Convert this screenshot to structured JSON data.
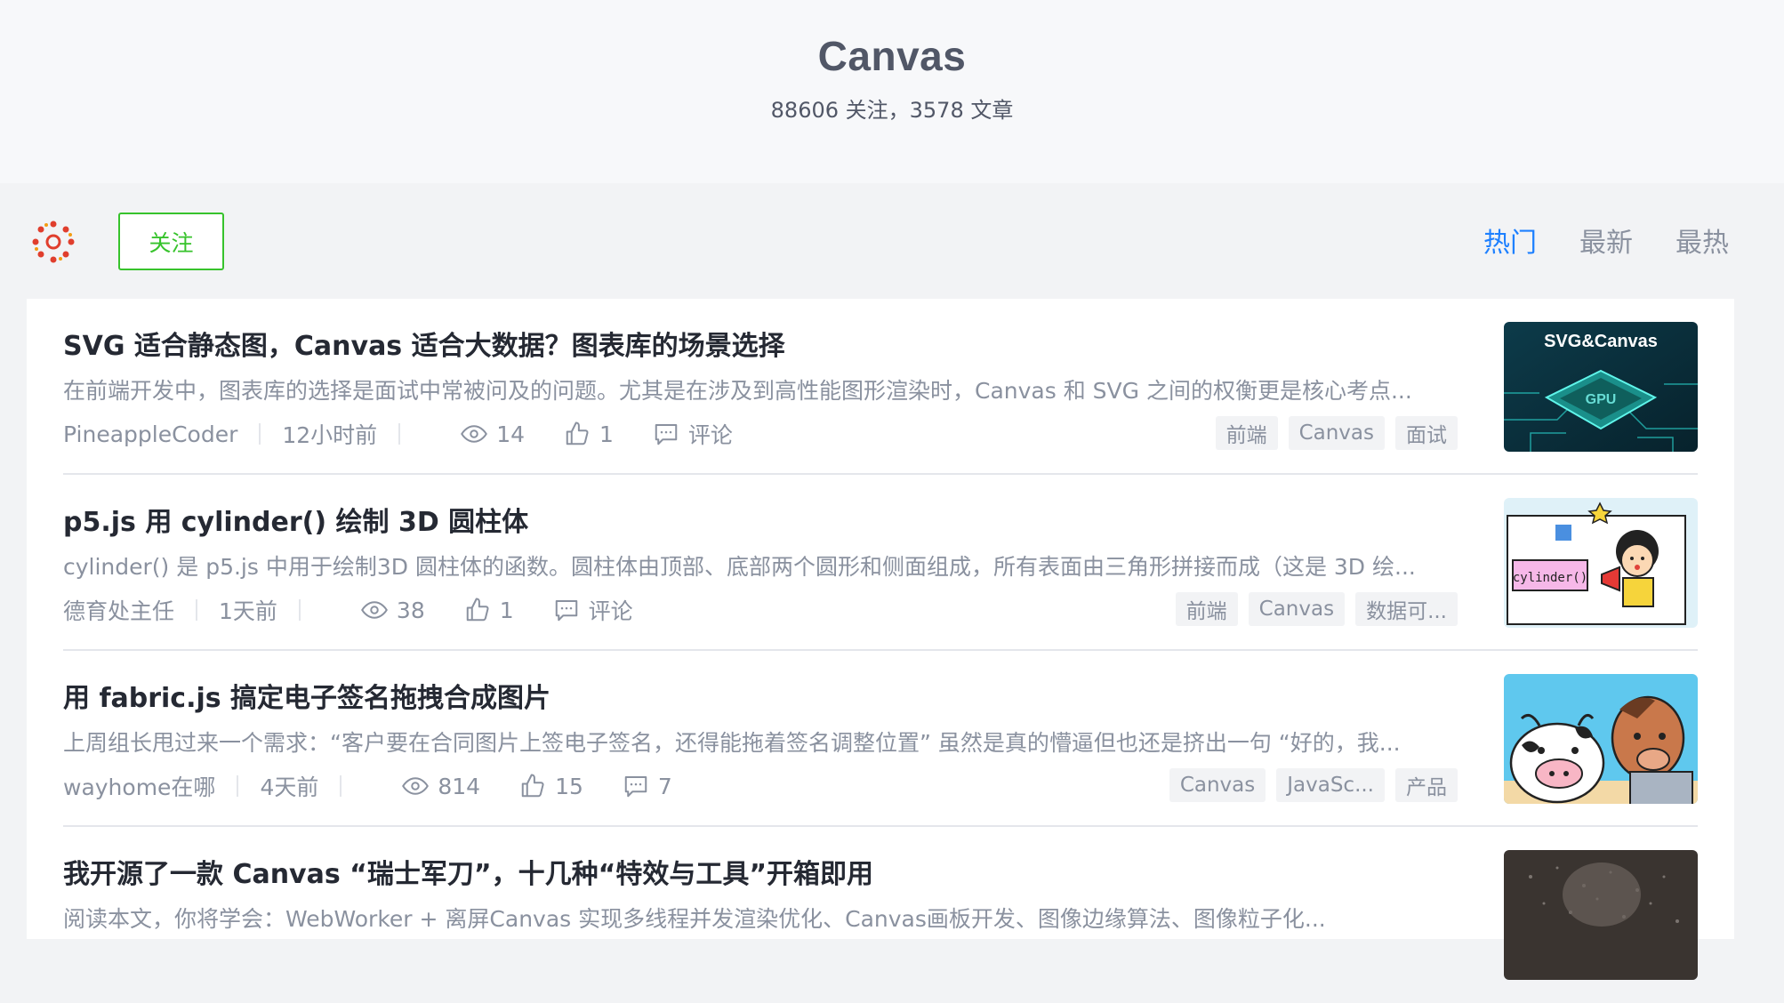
{
  "tag": {
    "title": "Canvas",
    "stats": "88606 关注，3578 文章",
    "follow_label": "关注"
  },
  "sort_tabs": [
    "热门",
    "最新",
    "最热"
  ],
  "entries": [
    {
      "title": "SVG 适合静态图，Canvas 适合大数据？图表库的场景选择",
      "abstract": "在前端开发中，图表库的选择是面试中常被问及的问题。尤其是在涉及到高性能图形渲染时，Canvas 和 SVG 之间的权衡更是核心考点...",
      "author": "PineappleCoder",
      "time": "12小时前",
      "views": "14",
      "likes": "1",
      "comments": "评论",
      "tags": [
        "前端",
        "Canvas",
        "面试"
      ],
      "thumb_text": "SVG&Canvas"
    },
    {
      "title": "p5.js 用 cylinder() 绘制 3D 圆柱体",
      "abstract": "cylinder() 是 p5.js 中用于绘制3D 圆柱体的函数。圆柱体由顶部、底部两个圆形和侧面组成，所有表面由三角形拼接而成（这是 3D 绘...",
      "author": "德育处主任",
      "time": "1天前",
      "views": "38",
      "likes": "1",
      "comments": "评论",
      "tags": [
        "前端",
        "Canvas",
        "数据可..."
      ],
      "thumb_text": "cylinder()"
    },
    {
      "title": "用 fabric.js 搞定电子签名拖拽合成图片",
      "abstract": "上周组长甩过来一个需求：“客户要在合同图片上签电子签名，还得能拖着签名调整位置” 虽然是真的懵逼但也还是挤出一句 “好的，我...",
      "author": "wayhome在哪",
      "time": "4天前",
      "views": "814",
      "likes": "15",
      "comments": "7",
      "tags": [
        "Canvas",
        "JavaSc...",
        "产品"
      ],
      "thumb_text": ""
    },
    {
      "title": "我开源了一款 Canvas “瑞士军刀”，十几种“特效与工具”开箱即用",
      "abstract": "阅读本文，你将学会：WebWorker + 离屏Canvas 实现多线程并发渲染优化、Canvas画板开发、图像边缘算法、图像粒子化...",
      "author": "",
      "time": "",
      "views": "",
      "likes": "",
      "comments": "",
      "tags": [],
      "thumb_text": ""
    }
  ],
  "colors": {
    "accent": "#1e80ff",
    "follow": "#37c32c",
    "muted": "#8a919f"
  }
}
